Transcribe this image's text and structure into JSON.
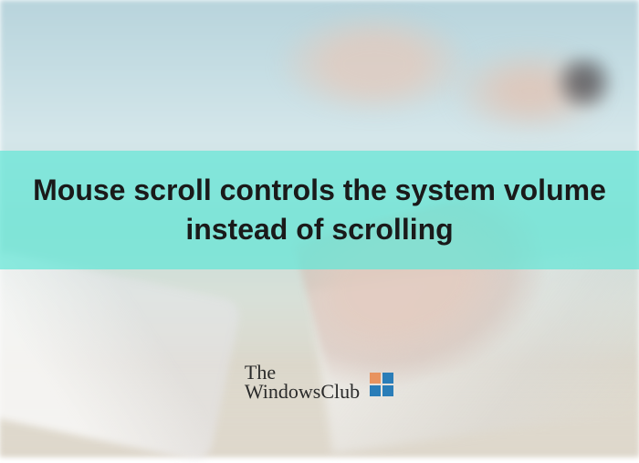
{
  "banner": {
    "title": "Mouse scroll controls the system volume instead of scrolling"
  },
  "logo": {
    "line1": "The",
    "line2": "WindowsClub"
  }
}
